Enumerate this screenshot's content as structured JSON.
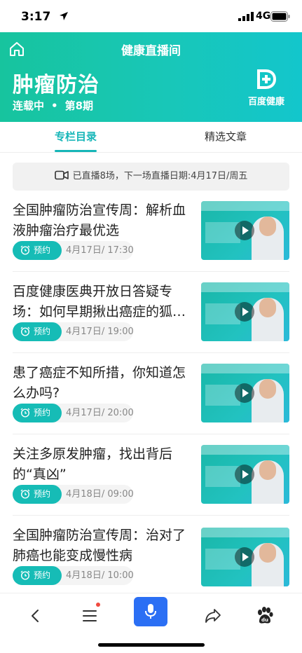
{
  "status_bar": {
    "time": "3:17",
    "network": "4G"
  },
  "header": {
    "title": "健康直播间",
    "column_title": "肿瘤防治",
    "status": "连载中",
    "episode": "第8期",
    "brand": "百度健康"
  },
  "tabs": [
    {
      "label": "专栏目录",
      "active": true
    },
    {
      "label": "精选文章",
      "active": false
    }
  ],
  "live_banner": {
    "text": "已直播8场，下一场直播日期:4月17日/周五"
  },
  "items": [
    {
      "title": "全国肿瘤防治宣传周：解析血液肿瘤治疗最优选",
      "action": "预约",
      "time": "4月17日/ 17:30"
    },
    {
      "title": "百度健康医典开放日答疑专场：如何早期揪出癌症的狐…",
      "action": "预约",
      "time": "4月17日/ 19:00"
    },
    {
      "title": "患了癌症不知所措，你知道怎么办吗?",
      "action": "预约",
      "time": "4月17日/ 20:00"
    },
    {
      "title": "关注多原发肿瘤，找出背后的“真凶”",
      "action": "预约",
      "time": "4月18日/ 09:00"
    },
    {
      "title": "全国肿瘤防治宣传周：治对了肺癌也能变成慢性病",
      "action": "预约",
      "time": "4月18日/ 10:00"
    }
  ],
  "icons": {
    "status": [
      "location-arrow-icon",
      "signal-icon",
      "battery-icon"
    ],
    "header": [
      "home-icon",
      "baidu-health-logo-icon"
    ],
    "banner": "video-camera-icon",
    "item": [
      "alarm-clock-icon",
      "play-icon"
    ],
    "bottom": [
      "back-arrow-icon",
      "menu-icon",
      "microphone-icon",
      "share-icon",
      "baidu-paw-icon"
    ]
  },
  "colors": {
    "accent": "#16bcb6",
    "voice_button": "#2b6ff4",
    "notification_dot": "#f04a3f"
  }
}
